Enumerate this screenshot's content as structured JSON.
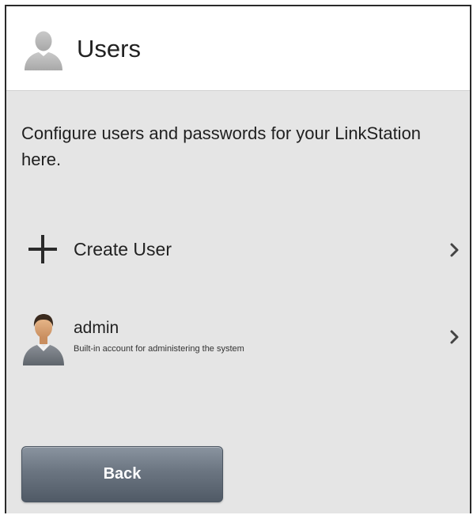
{
  "header": {
    "title": "Users",
    "icon": "user-silhouette-icon"
  },
  "description": "Configure users and passwords for your LinkStation here.",
  "create_user": {
    "label": "Create User",
    "icon": "plus-icon"
  },
  "users": [
    {
      "name": "admin",
      "description": "Built-in account for administering the system",
      "icon": "user-avatar-icon"
    }
  ],
  "back_button": {
    "label": "Back"
  },
  "colors": {
    "panel_background": "#e5e5e5",
    "header_background": "#ffffff",
    "button_top": "#8a949f",
    "button_bottom": "#505a66",
    "text": "#222222"
  }
}
